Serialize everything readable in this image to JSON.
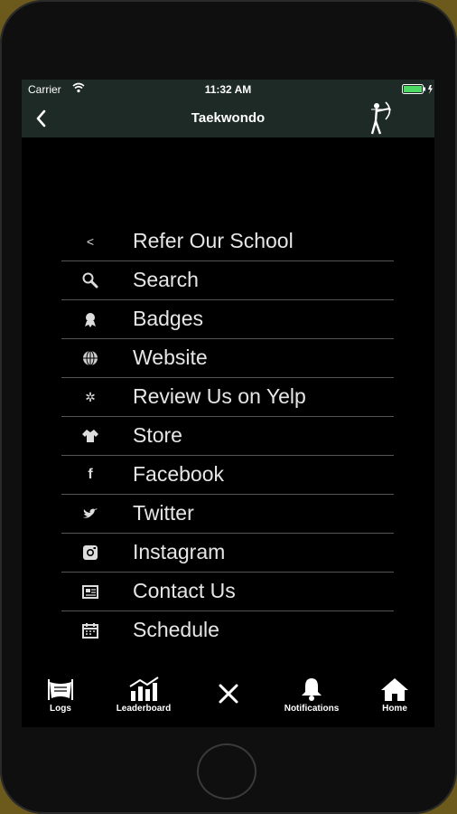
{
  "status_bar": {
    "carrier": "Carrier",
    "time": "11:32 AM"
  },
  "nav": {
    "title": "Taekwondo"
  },
  "menu": {
    "items": [
      {
        "label": "Refer Our School",
        "icon": "share-icon"
      },
      {
        "label": "Search",
        "icon": "search-icon"
      },
      {
        "label": "Badges",
        "icon": "badge-icon"
      },
      {
        "label": "Website",
        "icon": "globe-icon"
      },
      {
        "label": "Review Us on Yelp",
        "icon": "yelp-icon"
      },
      {
        "label": "Store",
        "icon": "uniform-icon"
      },
      {
        "label": "Facebook",
        "icon": "facebook-icon"
      },
      {
        "label": "Twitter",
        "icon": "twitter-icon"
      },
      {
        "label": "Instagram",
        "icon": "instagram-icon"
      },
      {
        "label": "Contact Us",
        "icon": "contact-card-icon"
      },
      {
        "label": "Schedule",
        "icon": "calendar-icon"
      }
    ]
  },
  "tabs": {
    "logs": "Logs",
    "leaderboard": "Leaderboard",
    "notifications": "Notifications",
    "home": "Home"
  },
  "colors": {
    "bar_background": "#1e2a26",
    "screen_background": "#000000",
    "divider": "#555555",
    "battery": "#4cd964"
  }
}
